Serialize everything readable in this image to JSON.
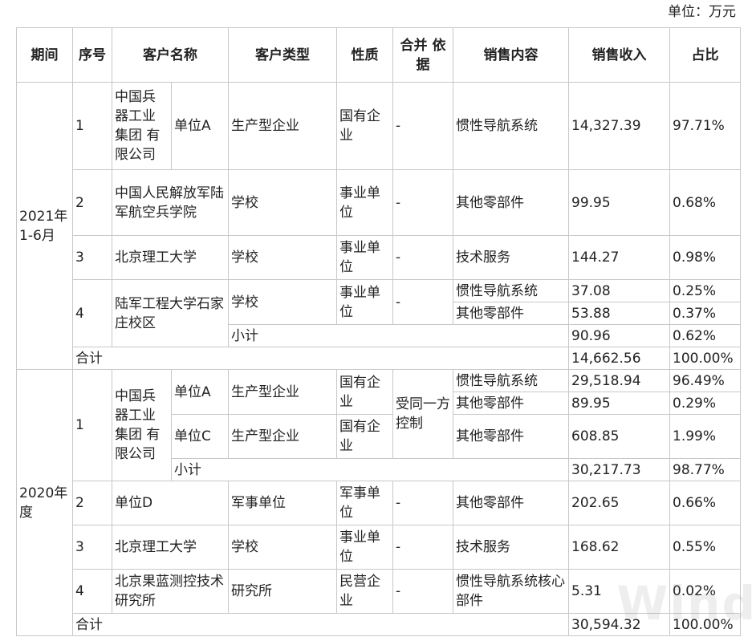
{
  "unit_label": "单位：万元",
  "header": {
    "period": "期间",
    "seq": "序号",
    "customer_name": "客户名称",
    "customer_type": "客户类型",
    "nature": "性质",
    "merge_basis": "合并 依据",
    "sales_content": "销售内容",
    "revenue": "销售收入",
    "share": "占比"
  },
  "p2021": {
    "period": "2021年1-6月",
    "r1": {
      "seq": "1",
      "group": "中国兵器工业集团 有限公司",
      "unit": "单位A",
      "type": "生产型企业",
      "nature": "国有企业",
      "merge": "-",
      "content": "惯性导航系统",
      "revenue": "14,327.39",
      "share": "97.71%"
    },
    "r2": {
      "seq": "2",
      "name": "中国人民解放军陆军航空兵学院",
      "type": "学校",
      "nature": "事业单位",
      "merge": "-",
      "content": "其他零部件",
      "revenue": "99.95",
      "share": "0.68%"
    },
    "r3": {
      "seq": "3",
      "name": "北京理工大学",
      "type": "学校",
      "nature": "事业单位",
      "merge": "-",
      "content": "技术服务",
      "revenue": "144.27",
      "share": "0.98%"
    },
    "r4": {
      "seq": "4",
      "name": "陆军工程大学石家庄校区",
      "type": "学校",
      "nature": "事业单位",
      "merge": "-",
      "content_a": "惯性导航系统",
      "revenue_a": "37.08",
      "share_a": "0.25%",
      "content_b": "其他零部件",
      "revenue_b": "53.88",
      "share_b": "0.37%",
      "subtotal_label": "小计",
      "subtotal_revenue": "90.96",
      "subtotal_share": "0.62%"
    },
    "total": {
      "label": "合计",
      "revenue": "14,662.56",
      "share": "100.00%"
    }
  },
  "p2020": {
    "period": "2020年度",
    "r1": {
      "seq": "1",
      "group": "中国兵器工业集团 有限公司",
      "unit_a": "单位A",
      "type_a": "生产型企业",
      "nature_a": "国有企业",
      "merge": "受同一方控制",
      "content_a1": "惯性导航系统",
      "revenue_a1": "29,518.94",
      "share_a1": "96.49%",
      "content_a2": "其他零部件",
      "revenue_a2": "89.95",
      "share_a2": "0.29%",
      "unit_c": "单位C",
      "type_c": "生产型企业",
      "nature_c": "国有企业",
      "content_c": "其他零部件",
      "revenue_c": "608.85",
      "share_c": "1.99%",
      "subtotal_label": "小计",
      "subtotal_revenue": "30,217.73",
      "subtotal_share": "98.77%"
    },
    "r2": {
      "seq": "2",
      "name": "单位D",
      "type": "军事单位",
      "nature": "军事单位",
      "merge": "-",
      "content": "其他零部件",
      "revenue": "202.65",
      "share": "0.66%"
    },
    "r3": {
      "seq": "3",
      "name": "北京理工大学",
      "type": "学校",
      "nature": "事业单位",
      "merge": "-",
      "content": "技术服务",
      "revenue": "168.62",
      "share": "0.55%"
    },
    "r4": {
      "seq": "4",
      "name": "北京果蓝测控技术研究所",
      "type": "研究所",
      "nature": "民营企业",
      "merge": "-",
      "content": "惯性导航系统核心部件",
      "revenue": "5.31",
      "share": "0.02%"
    },
    "total": {
      "label": "合计",
      "revenue": "30,594.32",
      "share": "100.00%"
    }
  },
  "watermark": "Wind"
}
